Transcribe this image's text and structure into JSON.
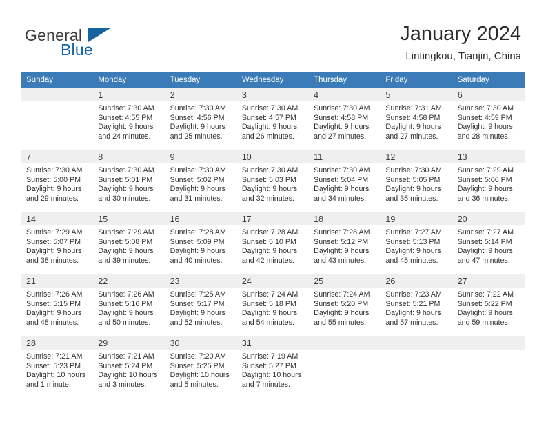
{
  "brand": {
    "name_part1": "General",
    "name_part2": "Blue",
    "triangle_icon": "triangle-icon",
    "accent_color": "#15639f"
  },
  "header": {
    "title": "January 2024",
    "subtitle": "Lintingkou, Tianjin, China"
  },
  "theme": {
    "header_row_bg": "#3b7cb8",
    "daynum_band_bg": "#efefef",
    "week_separator": "#2a6099",
    "text_color": "#333333"
  },
  "weekdays": [
    "Sunday",
    "Monday",
    "Tuesday",
    "Wednesday",
    "Thursday",
    "Friday",
    "Saturday"
  ],
  "weeks": [
    [
      {
        "day": "",
        "sunrise": "",
        "sunset": "",
        "daylight1": "",
        "daylight2": "",
        "empty": true
      },
      {
        "day": "1",
        "sunrise": "Sunrise: 7:30 AM",
        "sunset": "Sunset: 4:55 PM",
        "daylight1": "Daylight: 9 hours",
        "daylight2": "and 24 minutes.",
        "empty": false
      },
      {
        "day": "2",
        "sunrise": "Sunrise: 7:30 AM",
        "sunset": "Sunset: 4:56 PM",
        "daylight1": "Daylight: 9 hours",
        "daylight2": "and 25 minutes.",
        "empty": false
      },
      {
        "day": "3",
        "sunrise": "Sunrise: 7:30 AM",
        "sunset": "Sunset: 4:57 PM",
        "daylight1": "Daylight: 9 hours",
        "daylight2": "and 26 minutes.",
        "empty": false
      },
      {
        "day": "4",
        "sunrise": "Sunrise: 7:30 AM",
        "sunset": "Sunset: 4:58 PM",
        "daylight1": "Daylight: 9 hours",
        "daylight2": "and 27 minutes.",
        "empty": false
      },
      {
        "day": "5",
        "sunrise": "Sunrise: 7:31 AM",
        "sunset": "Sunset: 4:58 PM",
        "daylight1": "Daylight: 9 hours",
        "daylight2": "and 27 minutes.",
        "empty": false
      },
      {
        "day": "6",
        "sunrise": "Sunrise: 7:30 AM",
        "sunset": "Sunset: 4:59 PM",
        "daylight1": "Daylight: 9 hours",
        "daylight2": "and 28 minutes.",
        "empty": false
      }
    ],
    [
      {
        "day": "7",
        "sunrise": "Sunrise: 7:30 AM",
        "sunset": "Sunset: 5:00 PM",
        "daylight1": "Daylight: 9 hours",
        "daylight2": "and 29 minutes.",
        "empty": false
      },
      {
        "day": "8",
        "sunrise": "Sunrise: 7:30 AM",
        "sunset": "Sunset: 5:01 PM",
        "daylight1": "Daylight: 9 hours",
        "daylight2": "and 30 minutes.",
        "empty": false
      },
      {
        "day": "9",
        "sunrise": "Sunrise: 7:30 AM",
        "sunset": "Sunset: 5:02 PM",
        "daylight1": "Daylight: 9 hours",
        "daylight2": "and 31 minutes.",
        "empty": false
      },
      {
        "day": "10",
        "sunrise": "Sunrise: 7:30 AM",
        "sunset": "Sunset: 5:03 PM",
        "daylight1": "Daylight: 9 hours",
        "daylight2": "and 32 minutes.",
        "empty": false
      },
      {
        "day": "11",
        "sunrise": "Sunrise: 7:30 AM",
        "sunset": "Sunset: 5:04 PM",
        "daylight1": "Daylight: 9 hours",
        "daylight2": "and 34 minutes.",
        "empty": false
      },
      {
        "day": "12",
        "sunrise": "Sunrise: 7:30 AM",
        "sunset": "Sunset: 5:05 PM",
        "daylight1": "Daylight: 9 hours",
        "daylight2": "and 35 minutes.",
        "empty": false
      },
      {
        "day": "13",
        "sunrise": "Sunrise: 7:29 AM",
        "sunset": "Sunset: 5:06 PM",
        "daylight1": "Daylight: 9 hours",
        "daylight2": "and 36 minutes.",
        "empty": false
      }
    ],
    [
      {
        "day": "14",
        "sunrise": "Sunrise: 7:29 AM",
        "sunset": "Sunset: 5:07 PM",
        "daylight1": "Daylight: 9 hours",
        "daylight2": "and 38 minutes.",
        "empty": false
      },
      {
        "day": "15",
        "sunrise": "Sunrise: 7:29 AM",
        "sunset": "Sunset: 5:08 PM",
        "daylight1": "Daylight: 9 hours",
        "daylight2": "and 39 minutes.",
        "empty": false
      },
      {
        "day": "16",
        "sunrise": "Sunrise: 7:28 AM",
        "sunset": "Sunset: 5:09 PM",
        "daylight1": "Daylight: 9 hours",
        "daylight2": "and 40 minutes.",
        "empty": false
      },
      {
        "day": "17",
        "sunrise": "Sunrise: 7:28 AM",
        "sunset": "Sunset: 5:10 PM",
        "daylight1": "Daylight: 9 hours",
        "daylight2": "and 42 minutes.",
        "empty": false
      },
      {
        "day": "18",
        "sunrise": "Sunrise: 7:28 AM",
        "sunset": "Sunset: 5:12 PM",
        "daylight1": "Daylight: 9 hours",
        "daylight2": "and 43 minutes.",
        "empty": false
      },
      {
        "day": "19",
        "sunrise": "Sunrise: 7:27 AM",
        "sunset": "Sunset: 5:13 PM",
        "daylight1": "Daylight: 9 hours",
        "daylight2": "and 45 minutes.",
        "empty": false
      },
      {
        "day": "20",
        "sunrise": "Sunrise: 7:27 AM",
        "sunset": "Sunset: 5:14 PM",
        "daylight1": "Daylight: 9 hours",
        "daylight2": "and 47 minutes.",
        "empty": false
      }
    ],
    [
      {
        "day": "21",
        "sunrise": "Sunrise: 7:26 AM",
        "sunset": "Sunset: 5:15 PM",
        "daylight1": "Daylight: 9 hours",
        "daylight2": "and 48 minutes.",
        "empty": false
      },
      {
        "day": "22",
        "sunrise": "Sunrise: 7:26 AM",
        "sunset": "Sunset: 5:16 PM",
        "daylight1": "Daylight: 9 hours",
        "daylight2": "and 50 minutes.",
        "empty": false
      },
      {
        "day": "23",
        "sunrise": "Sunrise: 7:25 AM",
        "sunset": "Sunset: 5:17 PM",
        "daylight1": "Daylight: 9 hours",
        "daylight2": "and 52 minutes.",
        "empty": false
      },
      {
        "day": "24",
        "sunrise": "Sunrise: 7:24 AM",
        "sunset": "Sunset: 5:18 PM",
        "daylight1": "Daylight: 9 hours",
        "daylight2": "and 54 minutes.",
        "empty": false
      },
      {
        "day": "25",
        "sunrise": "Sunrise: 7:24 AM",
        "sunset": "Sunset: 5:20 PM",
        "daylight1": "Daylight: 9 hours",
        "daylight2": "and 55 minutes.",
        "empty": false
      },
      {
        "day": "26",
        "sunrise": "Sunrise: 7:23 AM",
        "sunset": "Sunset: 5:21 PM",
        "daylight1": "Daylight: 9 hours",
        "daylight2": "and 57 minutes.",
        "empty": false
      },
      {
        "day": "27",
        "sunrise": "Sunrise: 7:22 AM",
        "sunset": "Sunset: 5:22 PM",
        "daylight1": "Daylight: 9 hours",
        "daylight2": "and 59 minutes.",
        "empty": false
      }
    ],
    [
      {
        "day": "28",
        "sunrise": "Sunrise: 7:21 AM",
        "sunset": "Sunset: 5:23 PM",
        "daylight1": "Daylight: 10 hours",
        "daylight2": "and 1 minute.",
        "empty": false
      },
      {
        "day": "29",
        "sunrise": "Sunrise: 7:21 AM",
        "sunset": "Sunset: 5:24 PM",
        "daylight1": "Daylight: 10 hours",
        "daylight2": "and 3 minutes.",
        "empty": false
      },
      {
        "day": "30",
        "sunrise": "Sunrise: 7:20 AM",
        "sunset": "Sunset: 5:25 PM",
        "daylight1": "Daylight: 10 hours",
        "daylight2": "and 5 minutes.",
        "empty": false
      },
      {
        "day": "31",
        "sunrise": "Sunrise: 7:19 AM",
        "sunset": "Sunset: 5:27 PM",
        "daylight1": "Daylight: 10 hours",
        "daylight2": "and 7 minutes.",
        "empty": false
      },
      {
        "day": "",
        "sunrise": "",
        "sunset": "",
        "daylight1": "",
        "daylight2": "",
        "empty": true
      },
      {
        "day": "",
        "sunrise": "",
        "sunset": "",
        "daylight1": "",
        "daylight2": "",
        "empty": true
      },
      {
        "day": "",
        "sunrise": "",
        "sunset": "",
        "daylight1": "",
        "daylight2": "",
        "empty": true
      }
    ]
  ]
}
